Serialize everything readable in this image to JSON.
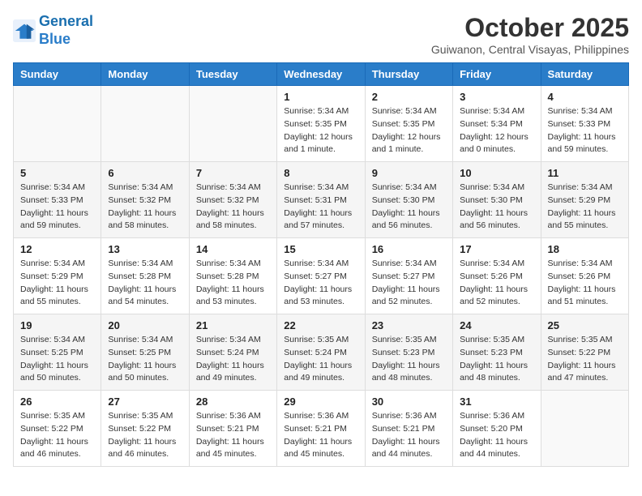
{
  "header": {
    "logo_line1": "General",
    "logo_line2": "Blue",
    "month": "October 2025",
    "location": "Guiwanon, Central Visayas, Philippines"
  },
  "weekdays": [
    "Sunday",
    "Monday",
    "Tuesday",
    "Wednesday",
    "Thursday",
    "Friday",
    "Saturday"
  ],
  "weeks": [
    [
      {
        "day": "",
        "info": ""
      },
      {
        "day": "",
        "info": ""
      },
      {
        "day": "",
        "info": ""
      },
      {
        "day": "1",
        "info": "Sunrise: 5:34 AM\nSunset: 5:35 PM\nDaylight: 12 hours\nand 1 minute."
      },
      {
        "day": "2",
        "info": "Sunrise: 5:34 AM\nSunset: 5:35 PM\nDaylight: 12 hours\nand 1 minute."
      },
      {
        "day": "3",
        "info": "Sunrise: 5:34 AM\nSunset: 5:34 PM\nDaylight: 12 hours\nand 0 minutes."
      },
      {
        "day": "4",
        "info": "Sunrise: 5:34 AM\nSunset: 5:33 PM\nDaylight: 11 hours\nand 59 minutes."
      }
    ],
    [
      {
        "day": "5",
        "info": "Sunrise: 5:34 AM\nSunset: 5:33 PM\nDaylight: 11 hours\nand 59 minutes."
      },
      {
        "day": "6",
        "info": "Sunrise: 5:34 AM\nSunset: 5:32 PM\nDaylight: 11 hours\nand 58 minutes."
      },
      {
        "day": "7",
        "info": "Sunrise: 5:34 AM\nSunset: 5:32 PM\nDaylight: 11 hours\nand 58 minutes."
      },
      {
        "day": "8",
        "info": "Sunrise: 5:34 AM\nSunset: 5:31 PM\nDaylight: 11 hours\nand 57 minutes."
      },
      {
        "day": "9",
        "info": "Sunrise: 5:34 AM\nSunset: 5:30 PM\nDaylight: 11 hours\nand 56 minutes."
      },
      {
        "day": "10",
        "info": "Sunrise: 5:34 AM\nSunset: 5:30 PM\nDaylight: 11 hours\nand 56 minutes."
      },
      {
        "day": "11",
        "info": "Sunrise: 5:34 AM\nSunset: 5:29 PM\nDaylight: 11 hours\nand 55 minutes."
      }
    ],
    [
      {
        "day": "12",
        "info": "Sunrise: 5:34 AM\nSunset: 5:29 PM\nDaylight: 11 hours\nand 55 minutes."
      },
      {
        "day": "13",
        "info": "Sunrise: 5:34 AM\nSunset: 5:28 PM\nDaylight: 11 hours\nand 54 minutes."
      },
      {
        "day": "14",
        "info": "Sunrise: 5:34 AM\nSunset: 5:28 PM\nDaylight: 11 hours\nand 53 minutes."
      },
      {
        "day": "15",
        "info": "Sunrise: 5:34 AM\nSunset: 5:27 PM\nDaylight: 11 hours\nand 53 minutes."
      },
      {
        "day": "16",
        "info": "Sunrise: 5:34 AM\nSunset: 5:27 PM\nDaylight: 11 hours\nand 52 minutes."
      },
      {
        "day": "17",
        "info": "Sunrise: 5:34 AM\nSunset: 5:26 PM\nDaylight: 11 hours\nand 52 minutes."
      },
      {
        "day": "18",
        "info": "Sunrise: 5:34 AM\nSunset: 5:26 PM\nDaylight: 11 hours\nand 51 minutes."
      }
    ],
    [
      {
        "day": "19",
        "info": "Sunrise: 5:34 AM\nSunset: 5:25 PM\nDaylight: 11 hours\nand 50 minutes."
      },
      {
        "day": "20",
        "info": "Sunrise: 5:34 AM\nSunset: 5:25 PM\nDaylight: 11 hours\nand 50 minutes."
      },
      {
        "day": "21",
        "info": "Sunrise: 5:34 AM\nSunset: 5:24 PM\nDaylight: 11 hours\nand 49 minutes."
      },
      {
        "day": "22",
        "info": "Sunrise: 5:35 AM\nSunset: 5:24 PM\nDaylight: 11 hours\nand 49 minutes."
      },
      {
        "day": "23",
        "info": "Sunrise: 5:35 AM\nSunset: 5:23 PM\nDaylight: 11 hours\nand 48 minutes."
      },
      {
        "day": "24",
        "info": "Sunrise: 5:35 AM\nSunset: 5:23 PM\nDaylight: 11 hours\nand 48 minutes."
      },
      {
        "day": "25",
        "info": "Sunrise: 5:35 AM\nSunset: 5:22 PM\nDaylight: 11 hours\nand 47 minutes."
      }
    ],
    [
      {
        "day": "26",
        "info": "Sunrise: 5:35 AM\nSunset: 5:22 PM\nDaylight: 11 hours\nand 46 minutes."
      },
      {
        "day": "27",
        "info": "Sunrise: 5:35 AM\nSunset: 5:22 PM\nDaylight: 11 hours\nand 46 minutes."
      },
      {
        "day": "28",
        "info": "Sunrise: 5:36 AM\nSunset: 5:21 PM\nDaylight: 11 hours\nand 45 minutes."
      },
      {
        "day": "29",
        "info": "Sunrise: 5:36 AM\nSunset: 5:21 PM\nDaylight: 11 hours\nand 45 minutes."
      },
      {
        "day": "30",
        "info": "Sunrise: 5:36 AM\nSunset: 5:21 PM\nDaylight: 11 hours\nand 44 minutes."
      },
      {
        "day": "31",
        "info": "Sunrise: 5:36 AM\nSunset: 5:20 PM\nDaylight: 11 hours\nand 44 minutes."
      },
      {
        "day": "",
        "info": ""
      }
    ]
  ]
}
